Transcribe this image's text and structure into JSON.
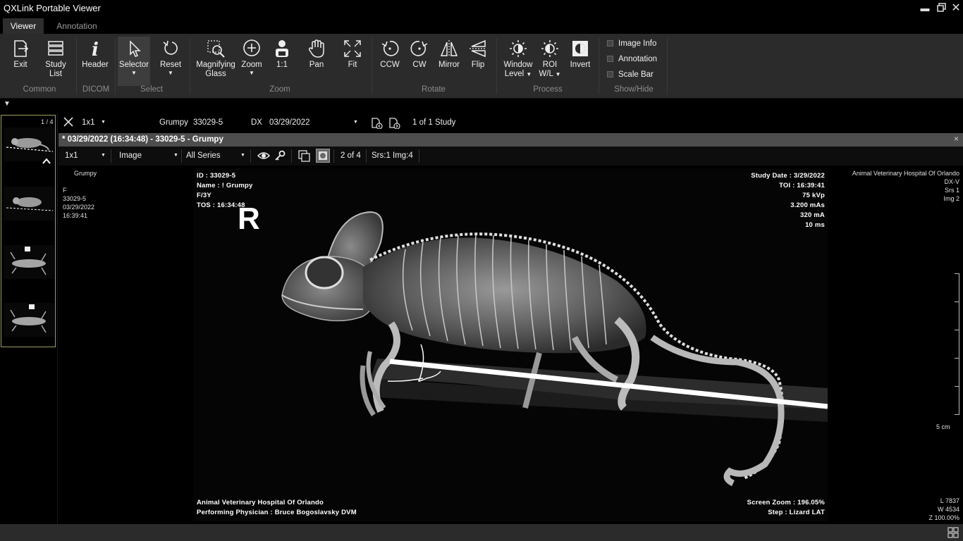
{
  "app": {
    "title": "QXLink Portable Viewer"
  },
  "tabs": [
    {
      "label": "Viewer",
      "active": true
    },
    {
      "label": "Annotation",
      "active": false
    }
  ],
  "ribbon": {
    "common": {
      "label": "Common",
      "exit": "Exit",
      "study_list_1": "Study",
      "study_list_2": "List"
    },
    "dicom": {
      "label": "DICOM",
      "header": "Header"
    },
    "select": {
      "label": "Select",
      "selector": "Selector",
      "reset": "Reset"
    },
    "zoom": {
      "label": "Zoom",
      "magnifying_1": "Magnifying",
      "magnifying_2": "Glass",
      "zoom": "Zoom",
      "one_to_one": "1:1",
      "pan": "Pan",
      "fit": "Fit"
    },
    "rotate": {
      "label": "Rotate",
      "ccw": "CCW",
      "cw": "CW",
      "mirror": "Mirror",
      "flip": "Flip"
    },
    "process": {
      "label": "Process",
      "window_1": "Window",
      "window_2": "Level",
      "roi_1": "ROI",
      "roi_2": "W/L",
      "invert": "Invert"
    },
    "showhide": {
      "label": "Show/Hide",
      "image_info": "Image Info",
      "annotation": "Annotation",
      "scale_bar": "Scale Bar"
    }
  },
  "thumbnails": {
    "count": "1 / 4"
  },
  "studybar": {
    "layout": "1x1",
    "patient": "Grumpy",
    "id": "33029-5",
    "modality": "DX",
    "date": "03/29/2022",
    "study_count": "1 of 1 Study"
  },
  "series_header": {
    "title": "* 03/29/2022 (16:34:48) - 33029-5 -          Grumpy"
  },
  "viewer_toolbar": {
    "layout": "1x1",
    "mode": "Image",
    "series": "All Series",
    "position": "2 of 4",
    "srs_img": "Srs:1 Img:4"
  },
  "left_info": {
    "name": "Grumpy",
    "sex": "F",
    "id": "33029-5",
    "date": "03/29/2022",
    "time": "16:39:41"
  },
  "overlay": {
    "top_left": [
      "ID : 33029-5",
      "Name :          ! Grumpy",
      "F/3Y",
      "TOS : 16:34:48"
    ],
    "top_right": [
      "Study Date : 3/29/2022",
      "TOI : 16:39:41",
      "75 kVp",
      "3.200 mAs",
      "320 mA",
      "10 ms"
    ],
    "bottom_left": [
      "Animal Veterinary Hospital Of Orlando",
      "Performing Physician : Bruce Bogoslavsky  DVM"
    ],
    "bottom_right": [
      "Screen Zoom : 196.05%",
      "Step : Lizard LAT"
    ],
    "marker": "R"
  },
  "right_info": {
    "lines": [
      "Animal Veterinary Hospital Of Orlando",
      "DX-V",
      "Srs 1",
      "Img 2"
    ],
    "scale": "5 cm",
    "wl": [
      "L 7837",
      "W 4534",
      "Z 100.00%"
    ]
  }
}
